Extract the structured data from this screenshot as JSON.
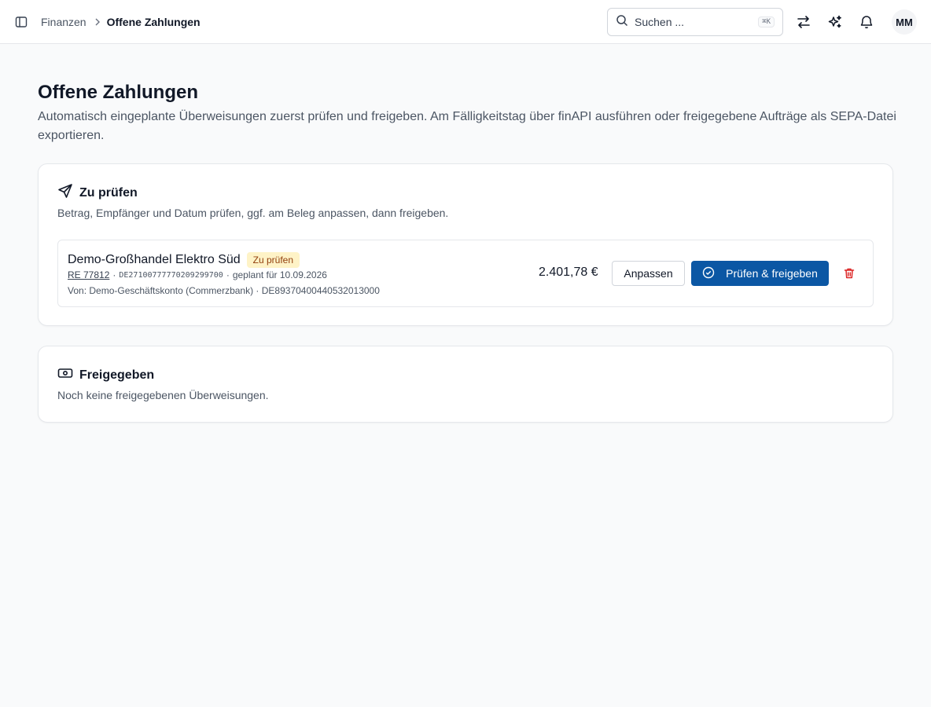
{
  "header": {
    "breadcrumb_parent": "Finanzen",
    "breadcrumb_current": "Offene Zahlungen",
    "search_placeholder": "Suchen ...",
    "search_shortcut": "⌘K",
    "avatar_initials": "MM",
    "icons": [
      "sidebar-toggle-icon",
      "search-icon",
      "swap-arrows-icon",
      "sparkles-icon",
      "bell-icon"
    ]
  },
  "page": {
    "title": "Offene Zahlungen",
    "description": "Automatisch eingeplante Überweisungen zuerst prüfen und freigeben. Am Fälligkeitstag über finAPI ausführen oder freigegebene Aufträge als SEPA-Datei exportieren."
  },
  "review_section": {
    "title": "Zu prüfen",
    "subtitle": "Betrag, Empfänger und Datum prüfen, ggf. am Beleg anpassen, dann freigeben.",
    "icon": "send-icon",
    "items": [
      {
        "payee": "Demo-Großhandel Elektro Süd",
        "status": "Zu prüfen",
        "reference": "RE 77812",
        "separator": "·",
        "payee_iban": "DE27100777770209299700",
        "scheduled": "geplant für 10.09.2026",
        "from_account": "Von: Demo-Geschäftskonto (Commerzbank) · DE89370400440532013000",
        "amount": "2.401,78 €",
        "adjust_label": "Anpassen",
        "approve_label": "Prüfen & freigeben"
      }
    ]
  },
  "approved_section": {
    "title": "Freigegeben",
    "empty_text": "Noch keine freigegebenen Überweisungen.",
    "icon": "banknote-icon"
  },
  "colors": {
    "primary": "#0b57a4",
    "badge_bg": "#fef3c7",
    "badge_text": "#92400e",
    "danger": "#dc2626",
    "page_bg": "#f9fafb"
  }
}
